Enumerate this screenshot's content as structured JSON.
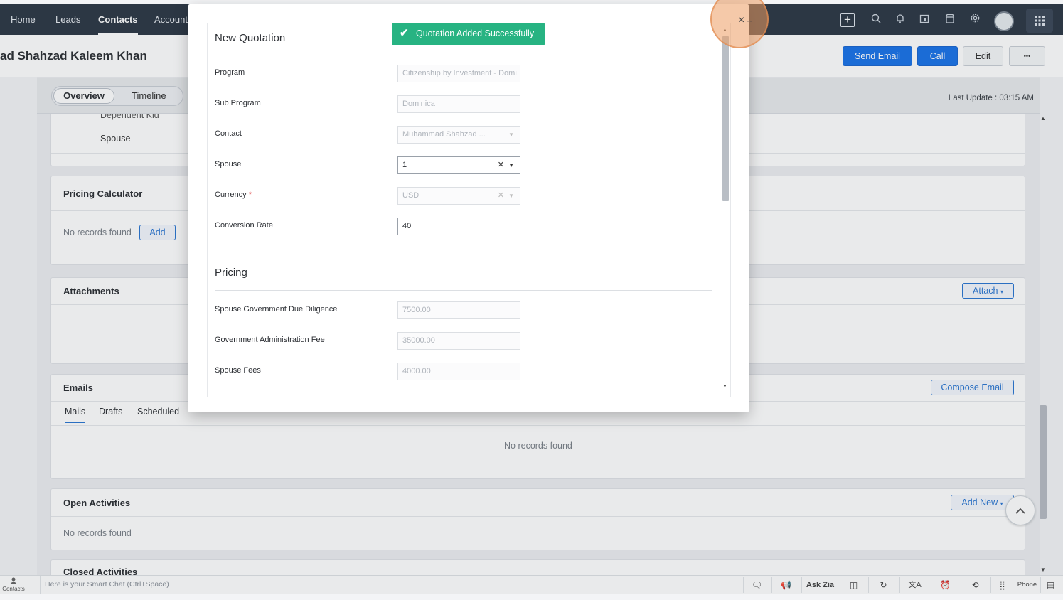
{
  "nav": {
    "items": [
      "Home",
      "Leads",
      "Contacts",
      "Account"
    ],
    "active": "Contacts",
    "icons": [
      "plus-square-icon",
      "search-icon",
      "bell-icon",
      "calendar-icon",
      "marketplace-icon",
      "gear-icon",
      "avatar",
      "apps-grid-icon"
    ]
  },
  "header": {
    "record_title": "ad Shahzad Kaleem Khan",
    "send_email": "Send Email",
    "call": "Call",
    "edit": "Edit",
    "more": "•••"
  },
  "subnav": {
    "overview": "Overview",
    "timeline": "Timeline",
    "last_update": "Last Update : 03:15 AM"
  },
  "cards": {
    "dependents": {
      "partial": "Dependent Kid",
      "spouse": "Spouse"
    },
    "pricing": {
      "title": "Pricing Calculator",
      "empty": "No records found",
      "add": "Add"
    },
    "attachments": {
      "title": "Attachments",
      "attach": "Attach"
    },
    "emails": {
      "title": "Emails",
      "compose": "Compose Email",
      "tabs": [
        "Mails",
        "Drafts",
        "Scheduled"
      ],
      "empty": "No records found"
    },
    "open_activities": {
      "title": "Open Activities",
      "add_new": "Add New",
      "empty": "No records found"
    },
    "closed_activities": {
      "title": "Closed Activities"
    }
  },
  "modal": {
    "title": "New Quotation",
    "toast": "Quotation Added Successfully",
    "close": "×",
    "section_pricing": "Pricing",
    "fields": [
      {
        "label": "Program",
        "value": "Citizenship by Investment - Domi"
      },
      {
        "label": "Sub Program",
        "value": "Dominica"
      },
      {
        "label": "Contact",
        "value": "Muhammad Shahzad ..."
      },
      {
        "label": "Spouse",
        "value": "1"
      },
      {
        "label": "Currency",
        "value": "USD",
        "required": "*"
      },
      {
        "label": "Conversion Rate",
        "value": "40"
      },
      {
        "label": "Spouse Government Due Diligence",
        "value": "7500.00"
      },
      {
        "label": "Government Administration Fee",
        "value": "35000.00"
      },
      {
        "label": "Spouse Fees",
        "value": "4000.00"
      }
    ]
  },
  "bottombar": {
    "contacts_label": "Contacts",
    "chat_placeholder": "Here is your Smart Chat (Ctrl+Space)",
    "ask_zia": "Ask Zia",
    "phone": "Phone"
  }
}
